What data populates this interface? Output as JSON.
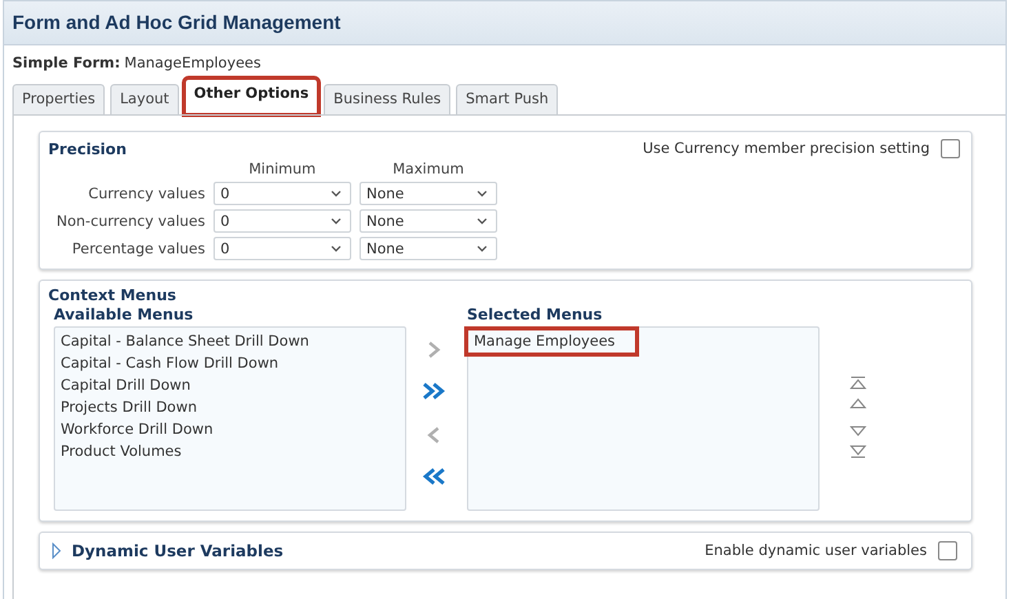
{
  "window": {
    "title": "Form and Ad Hoc Grid Management"
  },
  "form": {
    "label": "Simple Form:",
    "value": "ManageEmployees"
  },
  "tabs": [
    {
      "label": "Properties",
      "selected": false,
      "highlighted": false
    },
    {
      "label": "Layout",
      "selected": false,
      "highlighted": false
    },
    {
      "label": "Other Options",
      "selected": true,
      "highlighted": true
    },
    {
      "label": "Business Rules",
      "selected": false,
      "highlighted": false
    },
    {
      "label": "Smart Push",
      "selected": false,
      "highlighted": false
    }
  ],
  "precision": {
    "title": "Precision",
    "currency_option": {
      "label": "Use Currency member precision setting",
      "checked": false
    },
    "columns": [
      "Minimum",
      "Maximum"
    ],
    "rows": [
      {
        "label": "Currency values",
        "minimum": "0",
        "maximum": "None"
      },
      {
        "label": "Non-currency values",
        "minimum": "0",
        "maximum": "None"
      },
      {
        "label": "Percentage values",
        "minimum": "0",
        "maximum": "None"
      }
    ]
  },
  "context_menus": {
    "title": "Context Menus",
    "available_title": "Available Menus",
    "selected_title": "Selected Menus",
    "available": [
      {
        "label": "Capital - Balance Sheet Drill Down",
        "highlighted": false
      },
      {
        "label": "Capital - Cash Flow Drill Down",
        "highlighted": false
      },
      {
        "label": "Capital Drill Down",
        "highlighted": false
      },
      {
        "label": "Projects Drill Down",
        "highlighted": false
      },
      {
        "label": "Workforce Drill Down",
        "highlighted": false
      },
      {
        "label": "Product Volumes",
        "highlighted": false
      }
    ],
    "selected": [
      {
        "label": "Manage Employees",
        "highlighted": true
      }
    ]
  },
  "dynamic_variables": {
    "title": "Dynamic User Variables",
    "expanded": false,
    "option": {
      "label": "Enable dynamic user variables",
      "checked": false
    }
  }
}
